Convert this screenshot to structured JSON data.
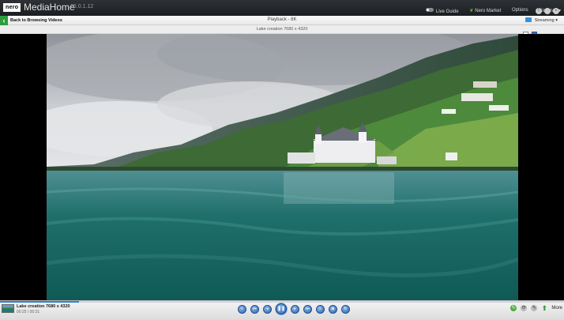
{
  "app": {
    "logo_text": "nero",
    "name": "MediaHome",
    "version": "25.0.1.12"
  },
  "top_menu": {
    "live_guide": "Live Guide",
    "nero_market": "Nero Market",
    "options": "Options",
    "account": "KinaHan ▾"
  },
  "nav": {
    "back_label": "Back to Browsing Videos",
    "title": "Playback - 8K",
    "streaming_label": "Streaming ▾"
  },
  "file": {
    "title": "Lake creation 7680 x 4320"
  },
  "player": {
    "now_playing_title": "Lake creation 7680 x 4320",
    "time": "00:25 / 00:31",
    "progress_fraction": 0.14
  },
  "controls": {
    "rewind": "«",
    "prev": "⏮",
    "step_back": "◂",
    "play_pause": "❚❚",
    "step_forward": "▸",
    "next": "⏭",
    "fast_forward": "»",
    "stop": "■",
    "repeat": "↻"
  },
  "right_tools": {
    "more_label": "More"
  },
  "colors": {
    "accent_blue": "#2f7fd0",
    "back_green": "#2c9d3c",
    "titlebar_bg": "#1c1e21"
  },
  "icons": {
    "back": "arrow-left-icon",
    "streaming": "streaming-icon",
    "live_guide": "toggle-icon",
    "nero_market": "leaf-icon"
  }
}
